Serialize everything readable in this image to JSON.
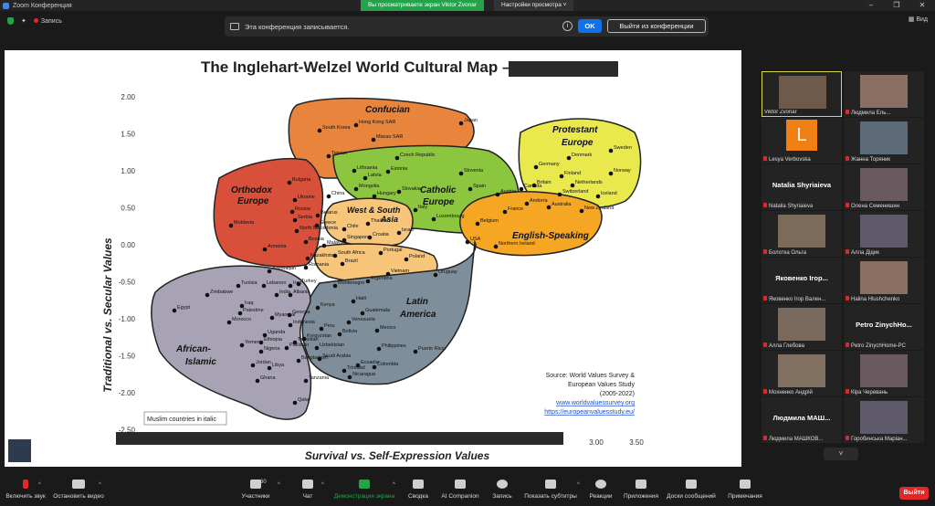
{
  "window": {
    "title": "Zoom Конференция"
  },
  "banner": {
    "sharing": "Вы просматриваете экран Viktor Zvonar",
    "view_settings": "Настройки просмотра"
  },
  "topbar": {
    "recording_label": "Запись",
    "view_label": "Вид"
  },
  "recording_notice": {
    "text": "Эта конференция записывается.",
    "ok_label": "OK",
    "exit_label": "Выйти из конференции"
  },
  "slide": {
    "title": "The Inglehart-Welzel World Cultural Map – 2023",
    "xlabel": "Survival vs. Self-Expression Values",
    "ylabel": "Traditional vs. Secular Values",
    "yticks": [
      "2.00",
      "1.50",
      "1.00",
      "0.50",
      "0.00",
      "-0.50",
      "-1.00",
      "-1.50",
      "-2.00",
      "-2.50"
    ],
    "xticks_visible": [
      "3.00",
      "3.50"
    ],
    "legend_note": "Muslim countries in italic",
    "source_lines": [
      "Source: World Values Survey &",
      "European Values Study",
      "(2005-2022)"
    ],
    "source_links": [
      "www.worldvaluessurvey.org",
      "https://europeanvaluesstudy.eu/"
    ],
    "regions": [
      {
        "id": "confucian",
        "label": "Confucian",
        "color": "#e8843c"
      },
      {
        "id": "orthodox",
        "label": "Orthodox\nEurope",
        "color": "#d9503a"
      },
      {
        "id": "catholic",
        "label": "Catholic\nEurope",
        "color": "#8cc63f"
      },
      {
        "id": "protestant",
        "label": "Protestant\nEurope",
        "color": "#e9e94e"
      },
      {
        "id": "english",
        "label": "English-Speaking",
        "color": "#f5a623"
      },
      {
        "id": "westsouth",
        "label": "West & South\nAsia",
        "color": "#f7c67a"
      },
      {
        "id": "latin",
        "label": "Latin\nAmerica",
        "color": "#7e8f9b"
      },
      {
        "id": "african",
        "label": "African-\nIslamic",
        "color": "#a8a3b4"
      }
    ],
    "countries": [
      "Japan",
      "South Korea",
      "Hong Kong SAR",
      "Macao SAR",
      "Taiwan",
      "Czech Republic",
      "Lithuania",
      "Latvia",
      "Estonia",
      "Slovenia",
      "Bulgaria",
      "Mongolia",
      "Slovakia",
      "Spain",
      "China",
      "Hungary",
      "Ukraine",
      "Russia",
      "Belarus",
      "Serbia",
      "Greece",
      "North Macedonia",
      "Moldavia",
      "Armenia",
      "Bosnia",
      "Kazakhstan",
      "Romania",
      "Azerbaijan",
      "Georgia",
      "Italy",
      "Austria",
      "France",
      "Luxembourg",
      "Belgium",
      "USA",
      "Northern Ireland",
      "Germany",
      "Britain",
      "Canada",
      "Andorra",
      "Australia",
      "New Zealand",
      "Denmark",
      "Finland",
      "Netherlands",
      "Switzerland",
      "Iceland",
      "Sweden",
      "Norway",
      "Thailand",
      "Chile",
      "Singapore",
      "Israel",
      "Croatia",
      "Malaysia",
      "South Africa",
      "Portugal",
      "Poland",
      "Vietnam",
      "Uruguay",
      "Argentina",
      "Brazil",
      "Montenegro",
      "Turkey",
      "Albania",
      "India",
      "Iran",
      "Lebanon",
      "Tunisia",
      "Iraq",
      "Zimbabwe",
      "Egypt",
      "Morocco",
      "Palestine",
      "Myanmar",
      "Indonesia",
      "Kenya",
      "Haiti",
      "Guatemala",
      "Venezuela",
      "Peru",
      "Mexico",
      "Bolivia",
      "Philippines",
      "Puerto Rico",
      "Ecuador",
      "Colombia",
      "Trinidad",
      "Nicaragua",
      "Uganda",
      "Ethiopia",
      "Yemen",
      "Libya",
      "Jordan",
      "Nigeria",
      "Pakistan",
      "Bangladesh",
      "Tajikistan",
      "Kyrgyzstan",
      "Uzbekistan",
      "Saudi Arabia",
      "Ghana",
      "Tanzania",
      "Qatar"
    ]
  },
  "participants": [
    {
      "name": "Viktor Zvonar",
      "active": true,
      "muted": false,
      "type": "video"
    },
    {
      "name": "Людмила Ель...",
      "active": false,
      "muted": true,
      "type": "video"
    },
    {
      "name": "Lesya Verbovska",
      "active": false,
      "muted": true,
      "type": "avatar",
      "initial": "L"
    },
    {
      "name": "Жанна Торяник",
      "active": false,
      "muted": true,
      "type": "video"
    },
    {
      "name": "Natalia Shyriaieva",
      "active": false,
      "muted": true,
      "type": "name",
      "display": "Natalia Shyriaieva"
    },
    {
      "name": "Олена Семенишин",
      "active": false,
      "muted": true,
      "type": "video"
    },
    {
      "name": "Болотка Ольга",
      "active": false,
      "muted": true,
      "type": "video"
    },
    {
      "name": "Алла Дідик",
      "active": false,
      "muted": true,
      "type": "video"
    },
    {
      "name": "Яковенко Ігор Вален...",
      "active": false,
      "muted": true,
      "type": "name",
      "display": "Яковенко Ігор..."
    },
    {
      "name": "Halina Hlushchenko",
      "active": false,
      "muted": true,
      "type": "video"
    },
    {
      "name": "Алла Глебова",
      "active": false,
      "muted": true,
      "type": "video"
    },
    {
      "name": "Petro ZinychHome-PC",
      "active": false,
      "muted": true,
      "type": "name",
      "display": "Petro ZinychHo..."
    },
    {
      "name": "Мохненко Андрій",
      "active": false,
      "muted": true,
      "type": "video"
    },
    {
      "name": "Кіра Черевань",
      "active": false,
      "muted": true,
      "type": "video"
    },
    {
      "name": "Людмила МАШКОВ...",
      "active": false,
      "muted": true,
      "type": "name",
      "display": "Людмила МАШ..."
    },
    {
      "name": "Горобинська Маріан...",
      "active": false,
      "muted": true,
      "type": "video"
    }
  ],
  "toolbar": {
    "unmute": "Включить звук",
    "video": "Остановить видео",
    "participants": "Участники",
    "participants_count": "60",
    "chat": "Чат",
    "share": "Демонстрация экрана",
    "summary": "Сводка",
    "ai": "AI Companion",
    "record": "Запись",
    "captions": "Показать субтитры",
    "reactions": "Реакции",
    "apps": "Приложения",
    "whiteboards": "Доски сообщений",
    "notes": "Примечания",
    "leave": "Выйти"
  },
  "colors": {
    "share_green": "#23a34a",
    "ok_blue": "#0e72ed",
    "leave_red": "#e02828",
    "active_border": "#d3d84a"
  }
}
